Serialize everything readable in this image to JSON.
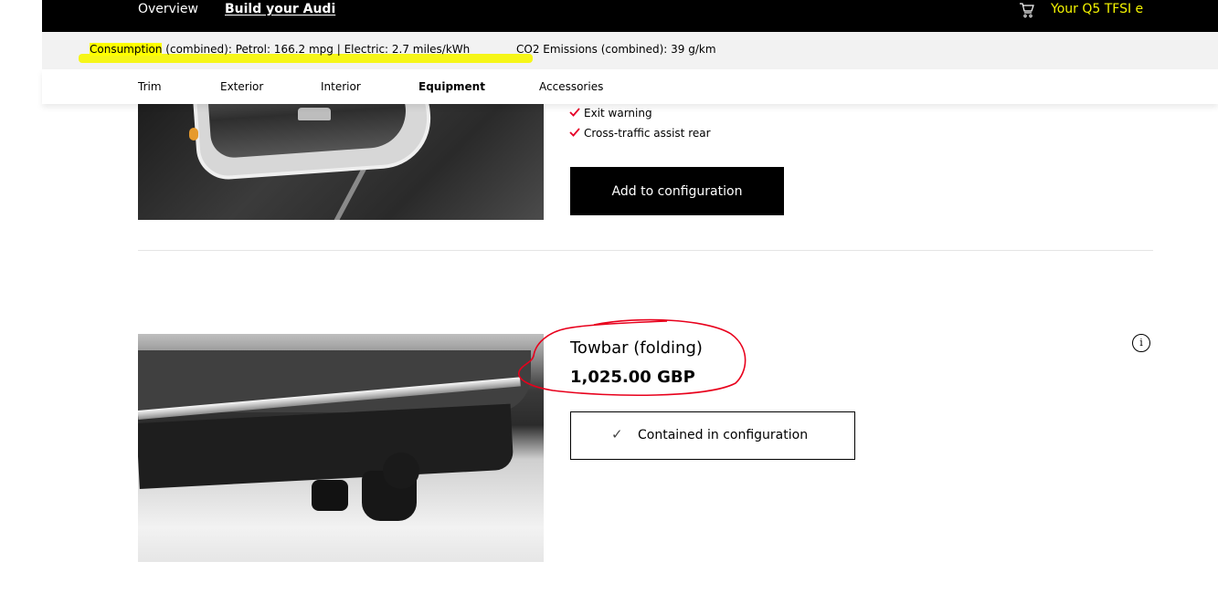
{
  "topnav": {
    "overview": "Overview",
    "build": "Build your Audi",
    "cart_label": "Your Q5 TFSI e",
    "accent_color": "#f5f500"
  },
  "consumption": {
    "label": "Consumption",
    "rest": " (combined): Petrol: 166.2 mpg | Electric: 2.7 miles/kWh",
    "co2": "CO2 Emissions (combined): 39 g/km"
  },
  "tabs": [
    {
      "label": "Trim",
      "active": false
    },
    {
      "label": "Exterior",
      "active": false
    },
    {
      "label": "Interior",
      "active": false
    },
    {
      "label": "Equipment",
      "active": true
    },
    {
      "label": "Accessories",
      "active": false
    }
  ],
  "prev_item": {
    "features": [
      "Exit warning",
      "Cross-traffic assist rear"
    ],
    "add_button": "Add to configuration",
    "check_color": "#e60028"
  },
  "product": {
    "name": "Towbar (folding)",
    "price": "1,025.00 GBP",
    "status_button": "Contained in configuration",
    "info_icon": "i"
  }
}
